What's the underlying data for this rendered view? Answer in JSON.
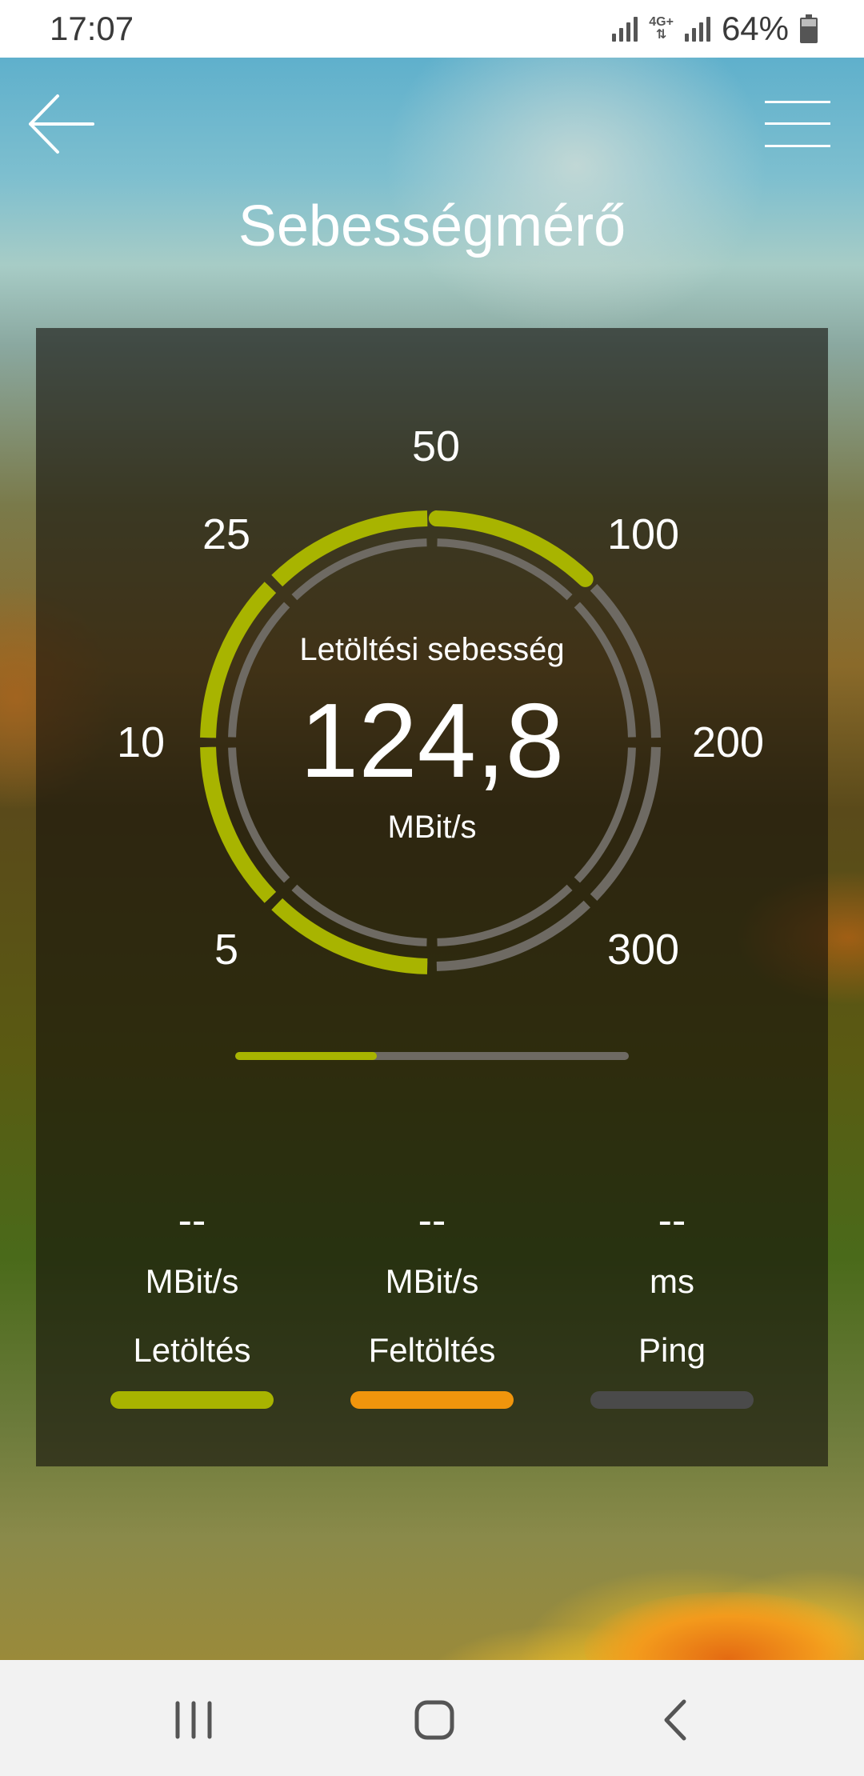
{
  "status_bar": {
    "time": "17:07",
    "network_type_top": "4G+",
    "battery": "64%",
    "icons": [
      "signal-icon",
      "network-4g-icon",
      "signal-icon",
      "battery-icon"
    ]
  },
  "header": {
    "title": "Sebességmérő",
    "back_icon": "arrow-left-icon",
    "menu_icon": "hamburger-menu-icon"
  },
  "gauge": {
    "label": "Letöltési sebesség",
    "value": "124,8",
    "unit": "MBit/s",
    "scale_labels": [
      "5",
      "10",
      "25",
      "50",
      "100",
      "200",
      "300"
    ],
    "level_fraction": 0.62,
    "accent_color": "#a8b400",
    "track_color": "#6e6a63"
  },
  "progress": {
    "fraction": 0.36
  },
  "stats": [
    {
      "value": "--",
      "unit": "MBit/s",
      "name": "Letöltés",
      "color": "#a8b400"
    },
    {
      "value": "--",
      "unit": "MBit/s",
      "name": "Feltöltés",
      "color": "#f0950c"
    },
    {
      "value": "--",
      "unit": "ms",
      "name": "Ping",
      "color": "#4a4a4a"
    }
  ],
  "nav_bar": {
    "icons": [
      "recent-apps-icon",
      "home-icon",
      "back-icon"
    ]
  }
}
